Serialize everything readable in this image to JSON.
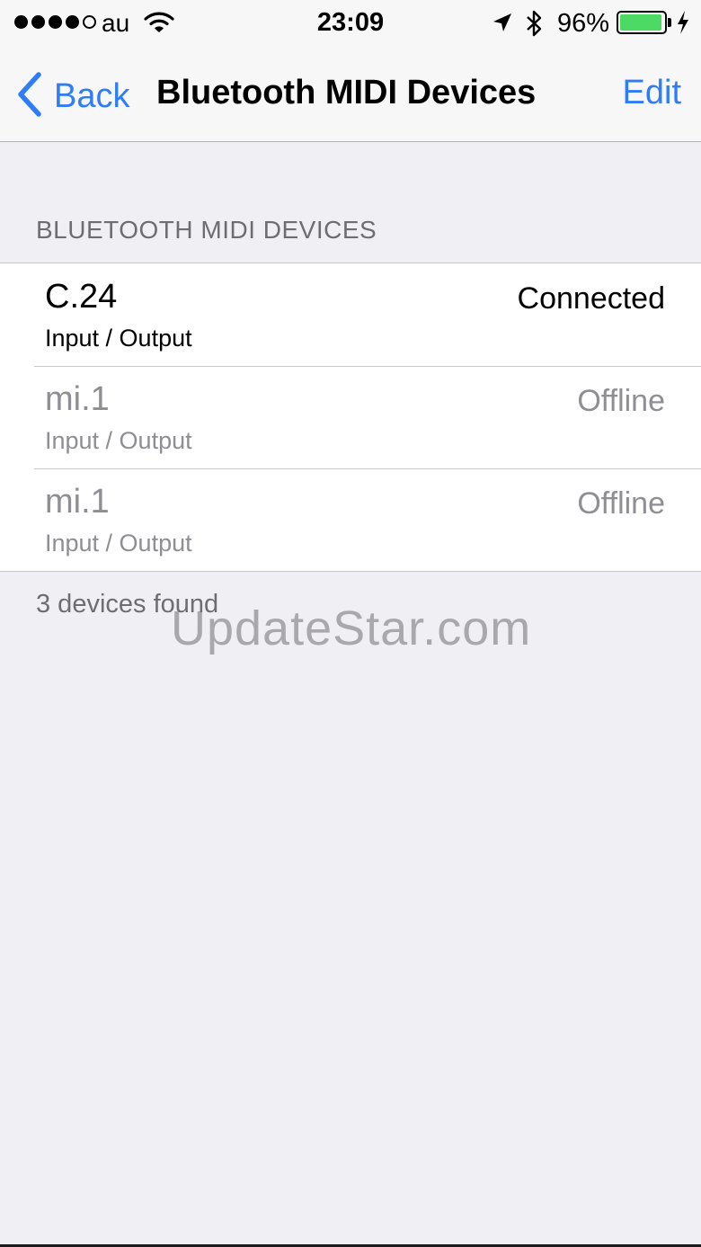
{
  "status_bar": {
    "carrier": "au",
    "time": "23:09",
    "battery_percent": "96%",
    "battery_level": 0.96,
    "signal_bars": 4,
    "signal_total": 5
  },
  "nav": {
    "back_label": "Back",
    "title": "Bluetooth MIDI Devices",
    "edit_label": "Edit"
  },
  "section": {
    "header": "BLUETOOTH MIDI DEVICES",
    "devices": [
      {
        "name": "C.24",
        "ports": "Input / Output",
        "status": "Connected"
      },
      {
        "name": "mi.1",
        "ports": "Input / Output",
        "status": "Offline"
      },
      {
        "name": "mi.1",
        "ports": "Input / Output",
        "status": "Offline"
      }
    ],
    "footer": "3 devices found"
  },
  "watermark": "UpdateStar.com",
  "colors": {
    "accent": "#2f7df6",
    "battery": "#4cd964",
    "background": "#efeff4"
  }
}
